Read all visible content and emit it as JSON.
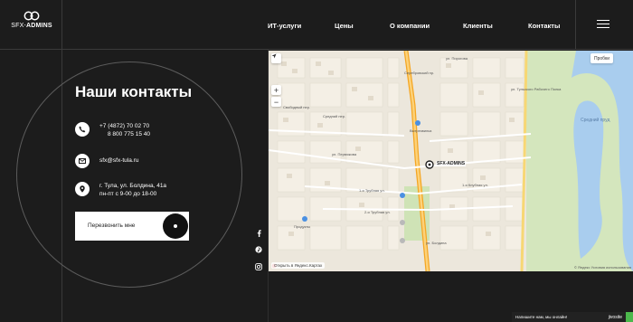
{
  "header": {
    "logo_text_light": "SFX-",
    "logo_text_bold": "ADMINS",
    "nav": [
      {
        "label": "ИТ-услуги"
      },
      {
        "label": "Цены"
      },
      {
        "label": "О компании"
      },
      {
        "label": "Клиенты"
      },
      {
        "label": "Контакты"
      }
    ]
  },
  "contacts": {
    "title": "Наши контакты",
    "phone_1": "+7 (4872) 70 02 70",
    "phone_2": "8 800 775 15 40",
    "email": "sfx@sfx-tula.ru",
    "address": "г. Тула, ул. Болдина, 41а",
    "hours": "пн-пт с 9-00 до 18-00",
    "callback_label": "Перезвонить мне"
  },
  "social": [
    "facebook-icon",
    "pinterest-icon",
    "instagram-icon"
  ],
  "map": {
    "traffic_label": "Пробки",
    "open_in_yandex": "Открыть в Яндекс.Картах",
    "copyright": "© Яндекс Условия использования",
    "marker_label": "SFX-ADMINS",
    "lake_label": "Средний пруд",
    "streets": [
      "Серебровский пр.",
      "ул. Пирогова",
      "ул. Пермяковa",
      "1-я Трубная ул.",
      "2-я Трубная ул.",
      "ул. Болдина",
      "ул. Тульского Рабочего Полка",
      "Продукты",
      "Вытрезвилка",
      "1-я Клубная ул.",
      "Свободный пер.",
      "Средний пер."
    ],
    "zoom_in": "+",
    "zoom_out": "−"
  },
  "chat": {
    "message": "Напишите нам, мы онлайн!",
    "brand": "jivosite"
  },
  "colors": {
    "background": "#1c1c1c",
    "accent_road": "#f5a623",
    "lake": "#a9cdee"
  }
}
